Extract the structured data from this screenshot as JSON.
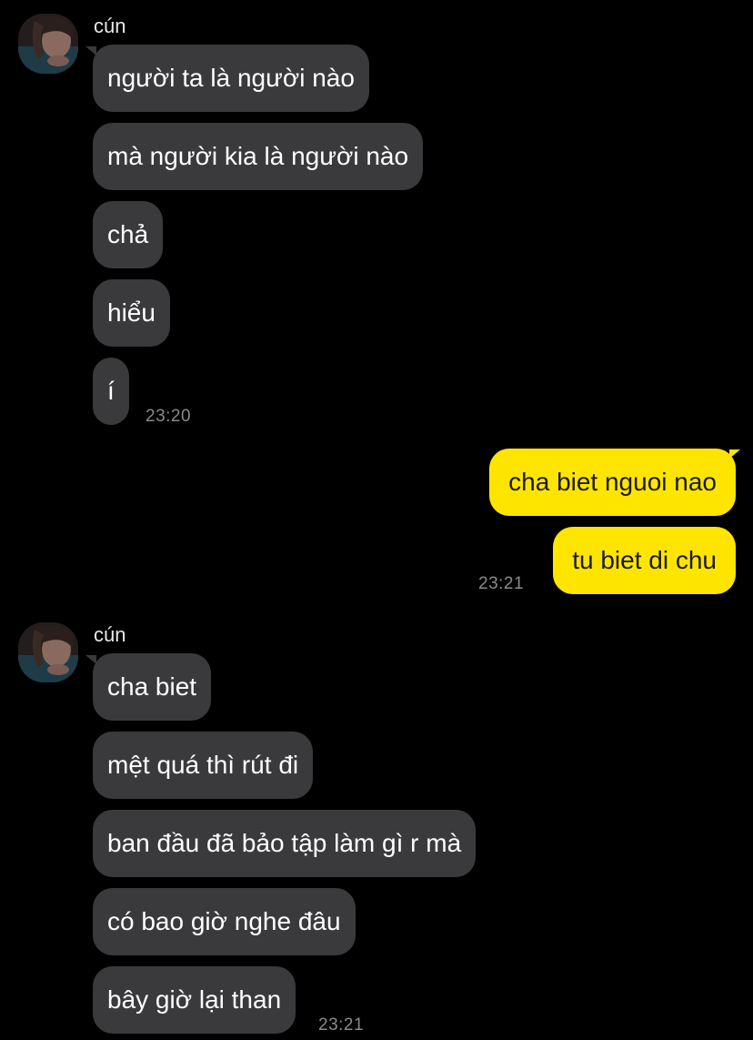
{
  "colors": {
    "background": "#000000",
    "incoming_bubble": "#3a3a3c",
    "outgoing_bubble": "#fee500",
    "timestamp": "#8a8a8a"
  },
  "group1": {
    "sender": "cún",
    "messages": [
      "người ta là người nào",
      "mà người kia là người nào",
      "chả",
      "hiểu",
      "í"
    ],
    "time": "23:20"
  },
  "group2": {
    "messages": [
      "cha biet nguoi nao",
      "tu biet di chu"
    ],
    "time": "23:21"
  },
  "group3": {
    "sender": "cún",
    "messages": [
      "cha biet",
      "mệt quá thì rút đi",
      "ban đầu đã bảo tập làm gì r mà",
      "có bao giờ nghe đâu",
      "bây giờ lại than"
    ],
    "time": "23:21"
  }
}
